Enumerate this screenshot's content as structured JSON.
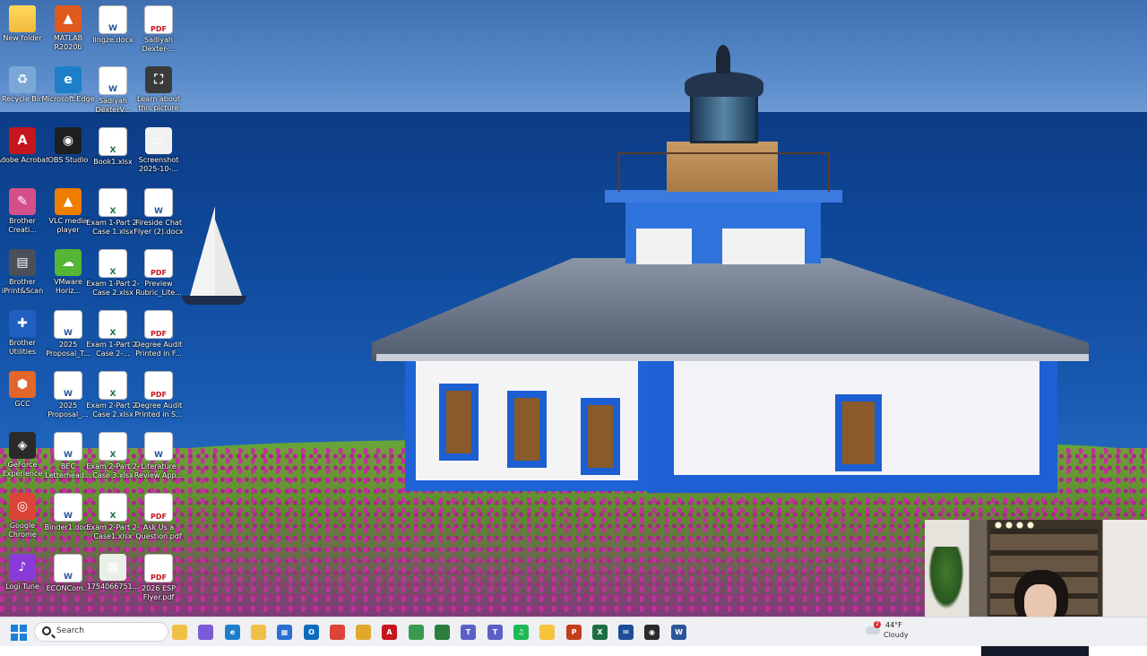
{
  "desktop": {
    "icons": [
      {
        "label": "New folder",
        "glyph": "",
        "kind": "folder",
        "color": "#f2b93b"
      },
      {
        "label": "MATLAB R2020b",
        "glyph": "▲",
        "kind": "app",
        "color": "#e0591e"
      },
      {
        "label": "lingze.docx",
        "glyph": "W",
        "kind": "doc",
        "color": "#2b579a"
      },
      {
        "label": "Sadiyah Dexter-...",
        "glyph": "PDF",
        "kind": "pdf",
        "color": "#c4161c"
      },
      {
        "label": "Recycle Bin",
        "glyph": "♻",
        "kind": "app",
        "color": "#7aa7d6"
      },
      {
        "label": "Microsoft Edge",
        "glyph": "e",
        "kind": "app",
        "color": "#1d7fc9"
      },
      {
        "label": "Sadiyah DexterV...",
        "glyph": "W",
        "kind": "doc",
        "color": "#2b579a"
      },
      {
        "label": "Learn about this picture",
        "glyph": "⛶",
        "kind": "app",
        "color": "#3a3a3a"
      },
      {
        "label": "Adobe Acrobat",
        "glyph": "A",
        "kind": "app",
        "color": "#c4161c"
      },
      {
        "label": "OBS Studio",
        "glyph": "◉",
        "kind": "app",
        "color": "#1f1f1f"
      },
      {
        "label": "Book1.xlsx",
        "glyph": "X",
        "kind": "xl",
        "color": "#1d6f42"
      },
      {
        "label": "Screenshot 2025-10-...",
        "glyph": "▭",
        "kind": "app",
        "color": "#f1f1f1"
      },
      {
        "label": "Brother Creati...",
        "glyph": "✎",
        "kind": "app",
        "color": "#d44f8a"
      },
      {
        "label": "VLC media player",
        "glyph": "▲",
        "kind": "app",
        "color": "#ef7d00"
      },
      {
        "label": "Exam 1-Part 2-Case 1.xlsx",
        "glyph": "X",
        "kind": "xl",
        "color": "#1d6f42"
      },
      {
        "label": "Fireside Chat Flyer (2).docx",
        "glyph": "W",
        "kind": "doc",
        "color": "#2b579a"
      },
      {
        "label": "Brother iPrint&Scan",
        "glyph": "▤",
        "kind": "app",
        "color": "#4a4f58"
      },
      {
        "label": "VMware Horiz...",
        "glyph": "☁",
        "kind": "app",
        "color": "#55b535"
      },
      {
        "label": "Exam 1-Part 2-Case 2.xlsx",
        "glyph": "X",
        "kind": "xl",
        "color": "#1d6f42"
      },
      {
        "label": "Preview Rubric_Lite...",
        "glyph": "PDF",
        "kind": "pdf",
        "color": "#c4161c"
      },
      {
        "label": "Brother Utilities",
        "glyph": "✚",
        "kind": "app",
        "color": "#1f5fbf"
      },
      {
        "label": "2025 Proposal_T...",
        "glyph": "W",
        "kind": "doc",
        "color": "#2b579a"
      },
      {
        "label": "Exam 1-Part 2-Case 2-...",
        "glyph": "X",
        "kind": "xl",
        "color": "#1d6f42"
      },
      {
        "label": "Degree Audit Printed in F...",
        "glyph": "PDF",
        "kind": "pdf",
        "color": "#c4161c"
      },
      {
        "label": "GCC",
        "glyph": "⬢",
        "kind": "app",
        "color": "#e4662a"
      },
      {
        "label": "2025 Proposal_...",
        "glyph": "W",
        "kind": "doc",
        "color": "#2b579a"
      },
      {
        "label": "Exam 2-Part 2-Case 2.xlsx",
        "glyph": "X",
        "kind": "xl",
        "color": "#1d6f42"
      },
      {
        "label": "Degree Audit Printed in S...",
        "glyph": "PDF",
        "kind": "pdf",
        "color": "#c4161c"
      },
      {
        "label": "GeForce Experience",
        "glyph": "◈",
        "kind": "app",
        "color": "#2a2a2a"
      },
      {
        "label": "BEC Letterhead...",
        "glyph": "W",
        "kind": "doc",
        "color": "#2b579a"
      },
      {
        "label": "Exam 2-Part 2-Case 3.xlsx",
        "glyph": "X",
        "kind": "xl",
        "color": "#1d6f42"
      },
      {
        "label": "Literature Review App...",
        "glyph": "W",
        "kind": "doc",
        "color": "#2b579a"
      },
      {
        "label": "Google Chrome",
        "glyph": "◎",
        "kind": "app",
        "color": "#db4437"
      },
      {
        "label": "Binder1.docx",
        "glyph": "W",
        "kind": "doc",
        "color": "#2b579a"
      },
      {
        "label": "Exam 2-Part 2-Case1.xlsx",
        "glyph": "X",
        "kind": "xl",
        "color": "#1d6f42"
      },
      {
        "label": "Ask Us a Question.pdf",
        "glyph": "PDF",
        "kind": "pdf",
        "color": "#c4161c"
      },
      {
        "label": "Logi Tune",
        "glyph": "♪",
        "kind": "app",
        "color": "#8a3ad8"
      },
      {
        "label": "ECONCom...",
        "glyph": "W",
        "kind": "doc",
        "color": "#2b579a"
      },
      {
        "label": "1754066751...",
        "glyph": "▦",
        "kind": "app",
        "color": "#e9efe7"
      },
      {
        "label": "2026 ESP Flyer.pdf",
        "glyph": "PDF",
        "kind": "pdf",
        "color": "#c4161c"
      }
    ]
  },
  "taskbar": {
    "search_placeholder": "Search",
    "apps": [
      {
        "name": "file-explorer-app",
        "glyph": "",
        "color": "#f0c046"
      },
      {
        "name": "copilot-app",
        "glyph": "",
        "color": "#7b5cd6"
      },
      {
        "name": "edge-app",
        "glyph": "e",
        "color": "#1d7fc9"
      },
      {
        "name": "folder-app",
        "glyph": "",
        "color": "#f0c046"
      },
      {
        "name": "store-app",
        "glyph": "▦",
        "color": "#2c6fd1"
      },
      {
        "name": "outlook-app",
        "glyph": "O",
        "color": "#0f6cbd"
      },
      {
        "name": "chrome-app",
        "glyph": "",
        "color": "#db4437"
      },
      {
        "name": "chrome-profile-app",
        "glyph": "",
        "color": "#e1a82b"
      },
      {
        "name": "acrobat-app",
        "glyph": "A",
        "color": "#c4161c"
      },
      {
        "name": "chrome-alt-app",
        "glyph": "",
        "color": "#3a9a4f"
      },
      {
        "name": "chrome-alt2-app",
        "glyph": "",
        "color": "#2a7d3a"
      },
      {
        "name": "teams-app",
        "glyph": "T",
        "color": "#5b5fc7"
      },
      {
        "name": "teams-alert-app",
        "glyph": "T",
        "color": "#5b5fc7"
      },
      {
        "name": "spotify-app",
        "glyph": "♫",
        "color": "#1db954"
      },
      {
        "name": "sticky-notes-app",
        "glyph": "",
        "color": "#f6c33c"
      },
      {
        "name": "powerpoint-app",
        "glyph": "P",
        "color": "#c43e1c"
      },
      {
        "name": "excel-app",
        "glyph": "X",
        "color": "#1d6f42"
      },
      {
        "name": "mail-app",
        "glyph": "✉",
        "color": "#1e4d9a"
      },
      {
        "name": "obs-app",
        "glyph": "◉",
        "color": "#2a2a2a"
      },
      {
        "name": "word-app",
        "glyph": "W",
        "color": "#2b579a"
      }
    ]
  },
  "weather": {
    "temp": "44°F",
    "desc": "Cloudy",
    "badge": "2"
  }
}
